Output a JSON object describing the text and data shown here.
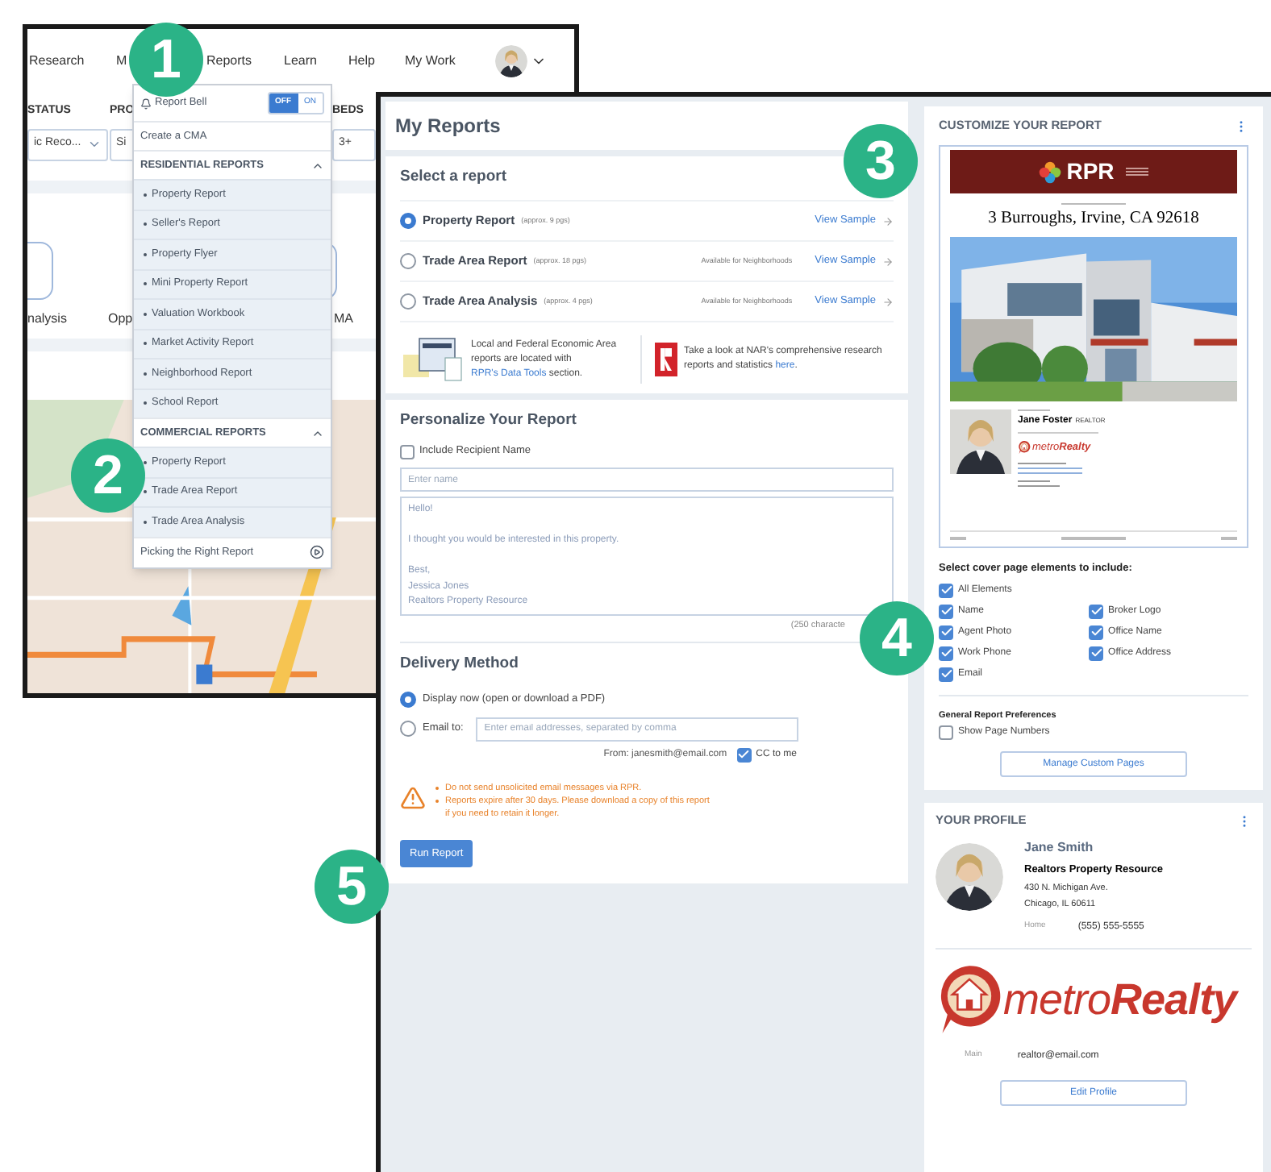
{
  "callouts": [
    {
      "number": "1"
    },
    {
      "number": "2"
    },
    {
      "number": "3"
    },
    {
      "number": "4"
    },
    {
      "number": "5"
    }
  ],
  "back_window": {
    "nav": [
      "Research",
      "M",
      "Reports",
      "Learn",
      "Help",
      "My Work"
    ],
    "filters": [
      {
        "label": "STATUS",
        "value": "ic Reco..."
      },
      {
        "label": "PRO",
        "value": "Si"
      },
      {
        "label": "BEDS",
        "value": "3+"
      }
    ],
    "tiles": [
      "nalysis",
      "Opp",
      "MA"
    ],
    "menu": {
      "bell_label": "Report Bell",
      "toggle": [
        {
          "label": "OFF",
          "selected": true
        },
        {
          "label": "ON",
          "selected": false
        }
      ],
      "create_cma": "Create a CMA",
      "sections": [
        {
          "title": "RESIDENTIAL REPORTS",
          "expanded": true,
          "items": [
            "Property Report",
            "Seller's Report",
            "Property Flyer",
            "Mini Property Report",
            "Valuation Workbook",
            "Market Activity Report",
            "Neighborhood Report",
            "School Report"
          ]
        },
        {
          "title": "COMMERCIAL REPORTS",
          "expanded": true,
          "items": [
            "Property Report",
            "Trade Area Report",
            "Trade Area Analysis"
          ]
        }
      ],
      "footer": "Picking the Right Report"
    }
  },
  "my_reports": {
    "title": "My Reports",
    "select_report": {
      "title": "Select a report",
      "options": [
        {
          "name": "Property Report",
          "pages": "(approx. 9 pgs)",
          "link": "View Sample",
          "selected": true
        },
        {
          "name": "Trade Area Report",
          "pages": "(approx. 18 pgs)",
          "note": "Available for Neighborhoods",
          "link": "View Sample",
          "selected": false
        },
        {
          "name": "Trade Area Analysis",
          "pages": "(approx. 4 pgs)",
          "note": "Available for Neighborhoods",
          "link": "View Sample",
          "selected": false
        }
      ],
      "info": [
        {
          "before": "Local and Federal Economic Area reports are located with",
          "link": "RPR's Data Tools",
          "after": "section."
        },
        {
          "before": "Take a look at NAR's comprehensive research reports and statistics",
          "link": "here",
          "after": "."
        }
      ]
    },
    "personalize": {
      "title": "Personalize Your Report",
      "recipient": {
        "label": "Include Recipient Name",
        "checked": false
      },
      "name_field": {
        "placeholder": "Enter name"
      },
      "message": {
        "placeholder": "Hello!\n\nI thought you would be interested in this property.\n\nBest,\nJessica Jones\nRealtors Property Resource"
      },
      "counter": "(250 characte"
    },
    "delivery": {
      "title": "Delivery Method",
      "options": [
        {
          "label": "Display now (open or download a PDF)",
          "selected": true
        },
        {
          "label": "Email to:",
          "selected": false
        }
      ],
      "email_field": {
        "placeholder": "Enter email addresses, separated by comma"
      },
      "from": "From: janesmith@email.com",
      "cc": {
        "label": "CC to me",
        "checked": true
      },
      "warnings": [
        "Do not send unsolicited email messages via RPR.",
        "Reports expire after 30 days. Please download a copy of this report if you need to retain it longer."
      ],
      "run_button": "Run Report"
    }
  },
  "customize": {
    "title": "CUSTOMIZE YOUR REPORT",
    "preview": {
      "brand": "RPR",
      "address": "3 Burroughs, Irvine, CA 92618",
      "agent_name": "Jane Foster",
      "agent_title": "REALTOR",
      "logo": "metro**Realty**"
    },
    "elements_title": "Select cover page elements to include:",
    "all_elements": {
      "label": "All Elements",
      "checked": true
    },
    "elements": [
      {
        "label": "Name",
        "checked": true
      },
      {
        "label": "Agent Photo",
        "checked": true
      },
      {
        "label": "Work Phone",
        "checked": true
      },
      {
        "label": "Email",
        "checked": true
      },
      {
        "label": "Broker Logo",
        "checked": true
      },
      {
        "label": "Office Name",
        "checked": true
      },
      {
        "label": "Office Address",
        "checked": true
      }
    ],
    "preferences_title": "General Report Preferences",
    "page_numbers": {
      "label": "Show Page Numbers",
      "checked": false
    },
    "button": "Manage Custom Pages"
  },
  "profile": {
    "title": "YOUR PROFILE",
    "name": "Jane Smith",
    "company": "Realtors Property Resource",
    "address": [
      "430 N. Michigan Ave.",
      "Chicago, IL 60611"
    ],
    "phone": {
      "label": "Home",
      "value": "(555) 555-5555"
    },
    "logo": "metro**Realty**",
    "email": {
      "label": "Main",
      "value": "realtor@email.com"
    },
    "button": "Edit Profile"
  }
}
